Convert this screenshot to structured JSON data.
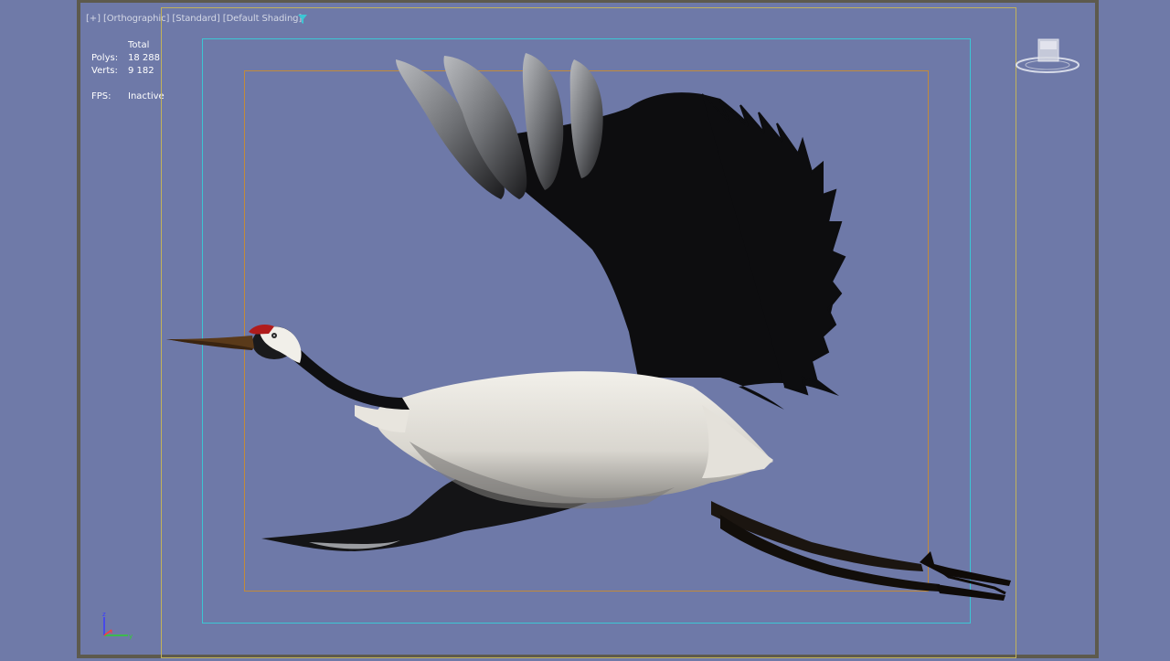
{
  "viewport": {
    "label_plus": "[+]",
    "label_view": "[Orthographic]",
    "label_style": "[Standard]",
    "label_shading": "[Default Shading]"
  },
  "stats": {
    "total_label": "Total",
    "polys_label": "Polys:",
    "polys_value": "18 288",
    "verts_label": "Verts:",
    "verts_value": "9 182",
    "fps_label": "FPS:",
    "fps_value": "Inactive"
  },
  "icons": {
    "filter": "filter-icon",
    "viewcube": "viewcube-icon",
    "axis": "axis-tripod-icon"
  },
  "colors": {
    "viewport_bg": "#6e79a8",
    "safe_frame_outer": "#c2b25a",
    "safe_frame_action": "#3cc6d4",
    "safe_frame_title": "#c28a3a"
  }
}
